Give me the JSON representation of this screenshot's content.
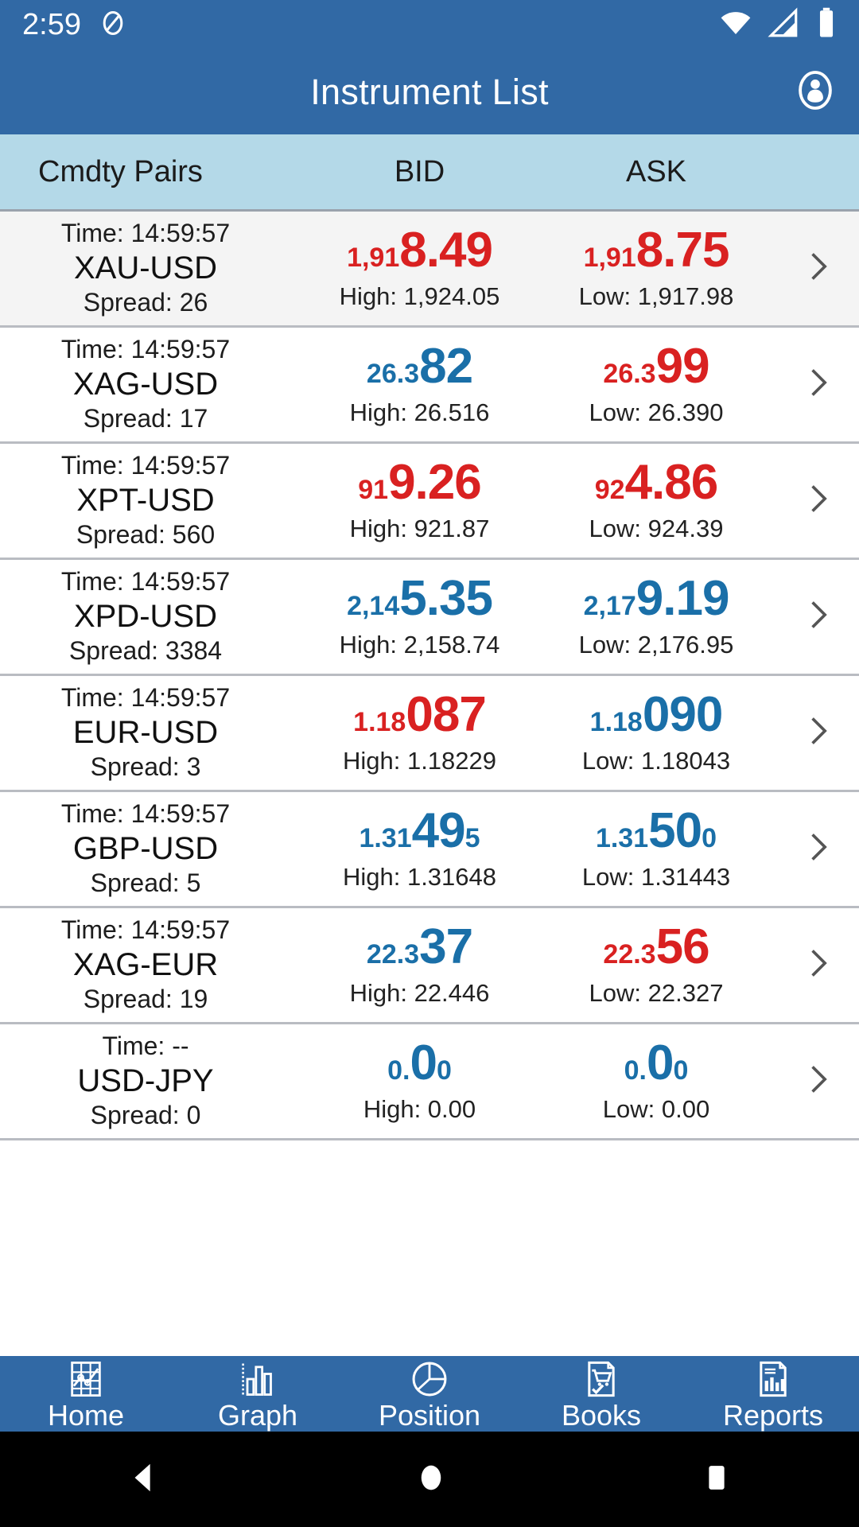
{
  "statusbar": {
    "time": "2:59",
    "icons": [
      "do-not-disturb-icon",
      "wifi-icon",
      "cellular-signal-icon",
      "battery-icon"
    ]
  },
  "appbar": {
    "title": "Instrument List",
    "account_icon": "account-circle-icon"
  },
  "colors": {
    "header_blue": "#3169A5",
    "colhead_blue": "#B4D9E8",
    "price_red": "#D92121",
    "price_blue": "#1A6FA8"
  },
  "columns": {
    "pairs": "Cmdty Pairs",
    "bid": "BID",
    "ask": "ASK"
  },
  "rows": [
    {
      "time": "Time: 14:59:57",
      "pair": "XAU-USD",
      "spread": "Spread: 26",
      "bid": {
        "pre": "1,91",
        "big": "8.49",
        "post": "",
        "color": "red"
      },
      "bid_hl": "High: 1,924.05",
      "ask": {
        "pre": "1,91",
        "big": "8.75",
        "post": "",
        "color": "red"
      },
      "ask_hl": "Low: 1,917.98"
    },
    {
      "time": "Time: 14:59:57",
      "pair": "XAG-USD",
      "spread": "Spread: 17",
      "bid": {
        "pre": "26.3",
        "big": "82",
        "post": "",
        "color": "blue"
      },
      "bid_hl": "High: 26.516",
      "ask": {
        "pre": "26.3",
        "big": "99",
        "post": "",
        "color": "red"
      },
      "ask_hl": "Low: 26.390"
    },
    {
      "time": "Time: 14:59:57",
      "pair": "XPT-USD",
      "spread": "Spread: 560",
      "bid": {
        "pre": "91",
        "big": "9.26",
        "post": "",
        "color": "red"
      },
      "bid_hl": "High: 921.87",
      "ask": {
        "pre": "92",
        "big": "4.86",
        "post": "",
        "color": "red"
      },
      "ask_hl": "Low: 924.39"
    },
    {
      "time": "Time: 14:59:57",
      "pair": "XPD-USD",
      "spread": "Spread: 3384",
      "bid": {
        "pre": "2,14",
        "big": "5.35",
        "post": "",
        "color": "blue"
      },
      "bid_hl": "High: 2,158.74",
      "ask": {
        "pre": "2,17",
        "big": "9.19",
        "post": "",
        "color": "blue"
      },
      "ask_hl": "Low: 2,176.95"
    },
    {
      "time": "Time: 14:59:57",
      "pair": "EUR-USD",
      "spread": "Spread: 3",
      "bid": {
        "pre": "1.18",
        "big": "087",
        "post": "",
        "color": "red"
      },
      "bid_hl": "High: 1.18229",
      "ask": {
        "pre": "1.18",
        "big": "090",
        "post": "",
        "color": "blue"
      },
      "ask_hl": "Low: 1.18043"
    },
    {
      "time": "Time: 14:59:57",
      "pair": "GBP-USD",
      "spread": "Spread: 5",
      "bid": {
        "pre": "1.31",
        "big": "49",
        "post": "5",
        "color": "blue"
      },
      "bid_hl": "High: 1.31648",
      "ask": {
        "pre": "1.31",
        "big": "50",
        "post": "0",
        "color": "blue"
      },
      "ask_hl": "Low: 1.31443"
    },
    {
      "time": "Time: 14:59:57",
      "pair": "XAG-EUR",
      "spread": "Spread: 19",
      "bid": {
        "pre": "22.3",
        "big": "37",
        "post": "",
        "color": "blue"
      },
      "bid_hl": "High: 22.446",
      "ask": {
        "pre": "22.3",
        "big": "56",
        "post": "",
        "color": "red"
      },
      "ask_hl": "Low: 22.327"
    },
    {
      "time": "Time: --",
      "pair": "USD-JPY",
      "spread": "Spread: 0",
      "bid": {
        "pre": "0.",
        "big": "0",
        "post": "0",
        "color": "blue"
      },
      "bid_hl": "High: 0.00",
      "ask": {
        "pre": "0.",
        "big": "0",
        "post": "0",
        "color": "blue"
      },
      "ask_hl": "Low: 0.00"
    }
  ],
  "bottomnav": [
    {
      "label": "Home",
      "icon": "home-grid-chart-icon"
    },
    {
      "label": "Graph",
      "icon": "bar-graph-icon"
    },
    {
      "label": "Position",
      "icon": "pie-chart-icon"
    },
    {
      "label": "Books",
      "icon": "order-book-cart-icon"
    },
    {
      "label": "Reports",
      "icon": "report-document-icon"
    }
  ],
  "sysnav": [
    {
      "icon": "back-triangle-icon"
    },
    {
      "icon": "home-circle-icon"
    },
    {
      "icon": "recents-square-icon"
    }
  ]
}
